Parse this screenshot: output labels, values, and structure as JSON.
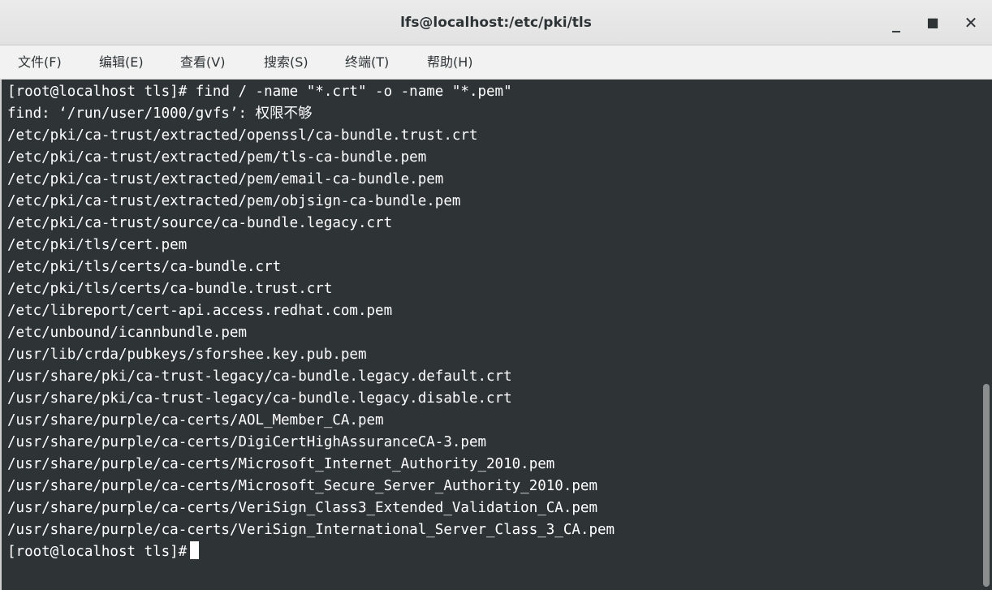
{
  "window": {
    "title": "lfs@localhost:/etc/pki/tls",
    "minimize_glyph": "_",
    "maximize_glyph": "■",
    "close_glyph": "✕"
  },
  "menu": {
    "file": "文件(F)",
    "edit": "编辑(E)",
    "view": "查看(V)",
    "search": "搜索(S)",
    "terminal": "终端(T)",
    "help": "帮助(H)"
  },
  "terminal": {
    "lines": [
      "[root@localhost tls]# find / -name \"*.crt\" -o -name \"*.pem\"",
      "find: ‘/run/user/1000/gvfs’: 权限不够",
      "/etc/pki/ca-trust/extracted/openssl/ca-bundle.trust.crt",
      "/etc/pki/ca-trust/extracted/pem/tls-ca-bundle.pem",
      "/etc/pki/ca-trust/extracted/pem/email-ca-bundle.pem",
      "/etc/pki/ca-trust/extracted/pem/objsign-ca-bundle.pem",
      "/etc/pki/ca-trust/source/ca-bundle.legacy.crt",
      "/etc/pki/tls/cert.pem",
      "/etc/pki/tls/certs/ca-bundle.crt",
      "/etc/pki/tls/certs/ca-bundle.trust.crt",
      "/etc/libreport/cert-api.access.redhat.com.pem",
      "/etc/unbound/icannbundle.pem",
      "/usr/lib/crda/pubkeys/sforshee.key.pub.pem",
      "/usr/share/pki/ca-trust-legacy/ca-bundle.legacy.default.crt",
      "/usr/share/pki/ca-trust-legacy/ca-bundle.legacy.disable.crt",
      "/usr/share/purple/ca-certs/AOL_Member_CA.pem",
      "/usr/share/purple/ca-certs/DigiCertHighAssuranceCA-3.pem",
      "/usr/share/purple/ca-certs/Microsoft_Internet_Authority_2010.pem",
      "/usr/share/purple/ca-certs/Microsoft_Secure_Server_Authority_2010.pem",
      "/usr/share/purple/ca-certs/VeriSign_Class3_Extended_Validation_CA.pem",
      "/usr/share/purple/ca-certs/VeriSign_International_Server_Class_3_CA.pem"
    ],
    "prompt": "[root@localhost tls]#"
  },
  "colors": {
    "terminal_bg": "#2e3436",
    "terminal_fg": "#ffffff",
    "titlebar_bg": "#e8e8e8",
    "menubar_bg": "#f2f2f2"
  }
}
